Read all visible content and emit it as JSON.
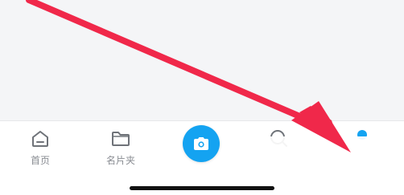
{
  "tab_bar": {
    "home_label": "首页",
    "cards_label": "名片夹",
    "camera_icon": "camera-icon",
    "search_icon": "search-icon",
    "profile_icon": "user-icon"
  },
  "colors": {
    "accent": "#14a3f1",
    "annotation_arrow": "#f0284a",
    "tab_label": "#8a8d93"
  }
}
